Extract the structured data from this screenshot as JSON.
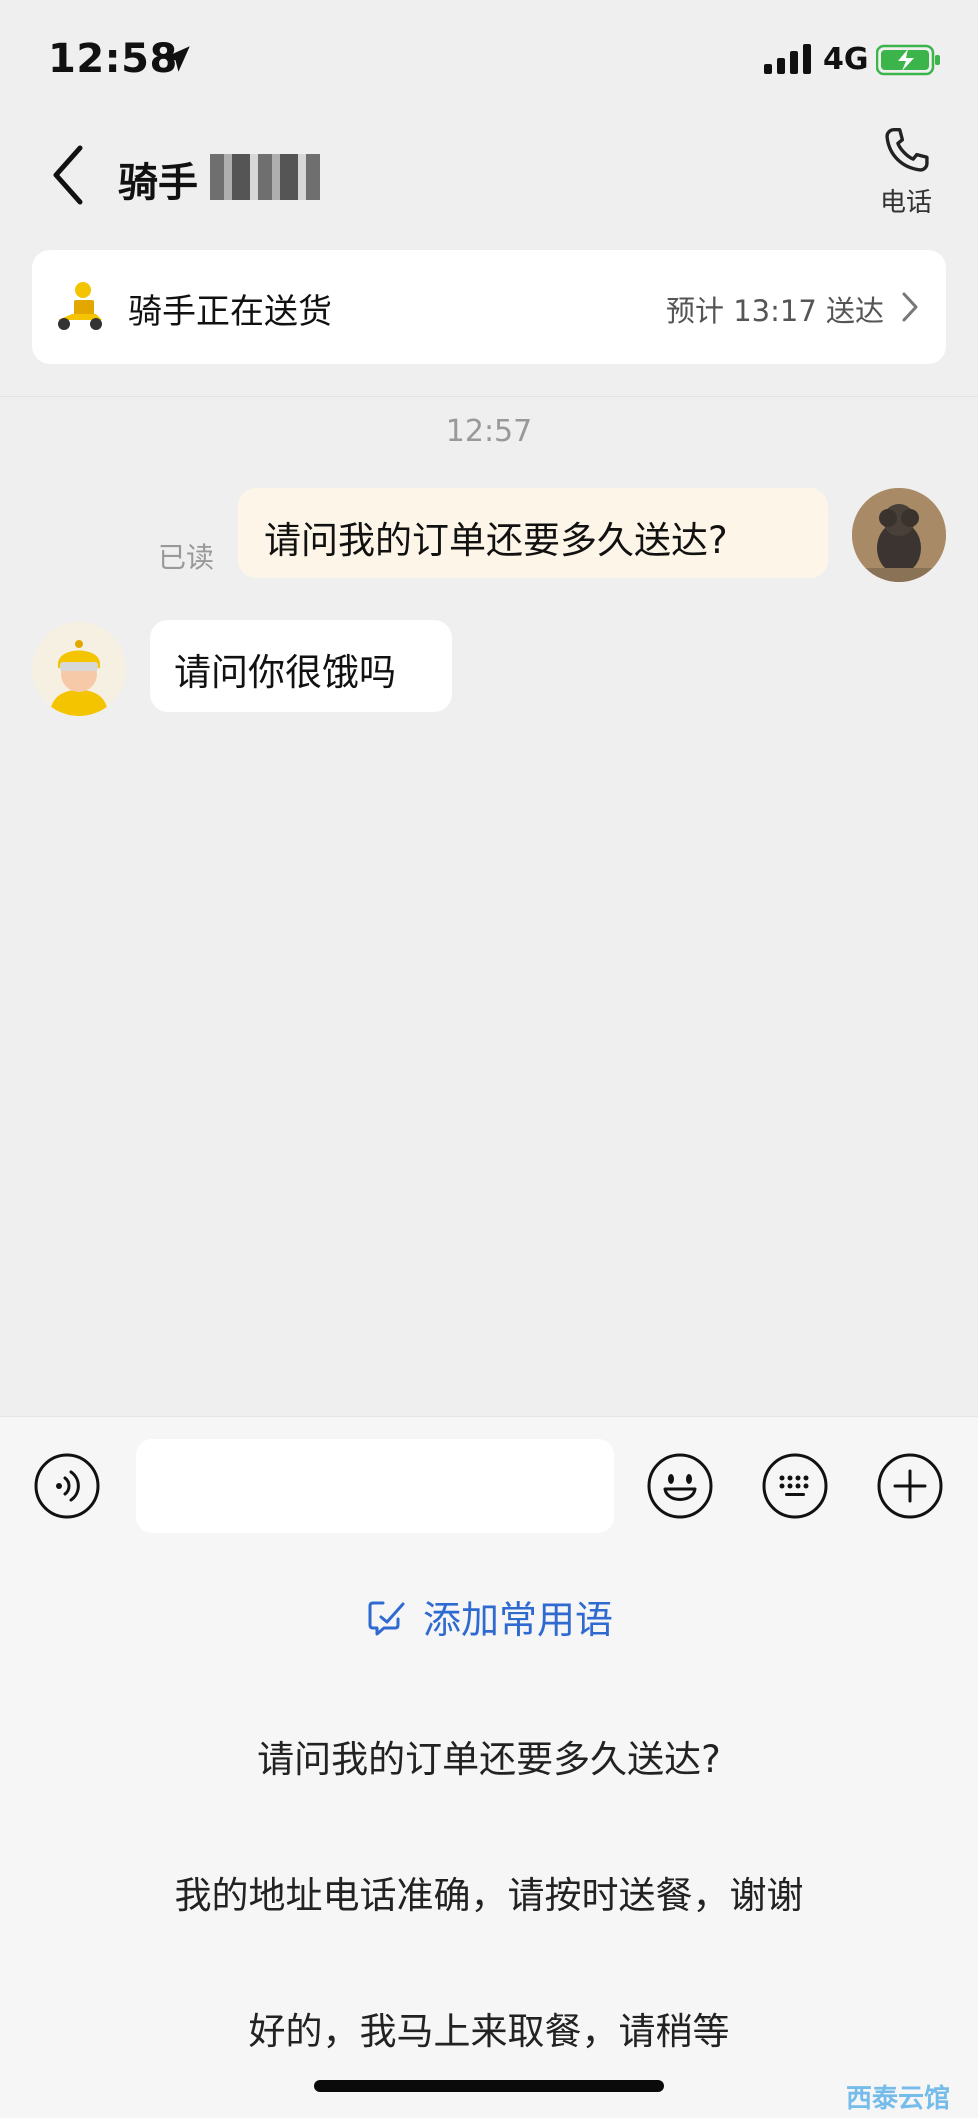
{
  "status_bar": {
    "time": "12:58",
    "network": "4G"
  },
  "header": {
    "title": "骑手",
    "title_suffix": "骑手",
    "phone_label": "电话"
  },
  "delivery": {
    "status": "骑手正在送货",
    "eta": "预计 13:17 送达"
  },
  "chat": {
    "timestamp": "12:57",
    "read_status": "已读",
    "messages": [
      {
        "from": "user",
        "text": "请问我的订单还要多久送达?"
      },
      {
        "from": "rider",
        "text": "请问你很饿吗"
      }
    ]
  },
  "composer": {
    "placeholder": ""
  },
  "quick_replies": {
    "add_label": "添加常用语",
    "items": [
      "请问我的订单还要多久送达?",
      "我的地址电话准确，请按时送餐，谢谢",
      "好的，我马上来取餐，请稍等"
    ]
  },
  "watermark": "西泰云馆",
  "colors": {
    "accent": "#2f6ad1",
    "outgoing_bubble": "#fdf6e8",
    "background": "#efeff0"
  }
}
